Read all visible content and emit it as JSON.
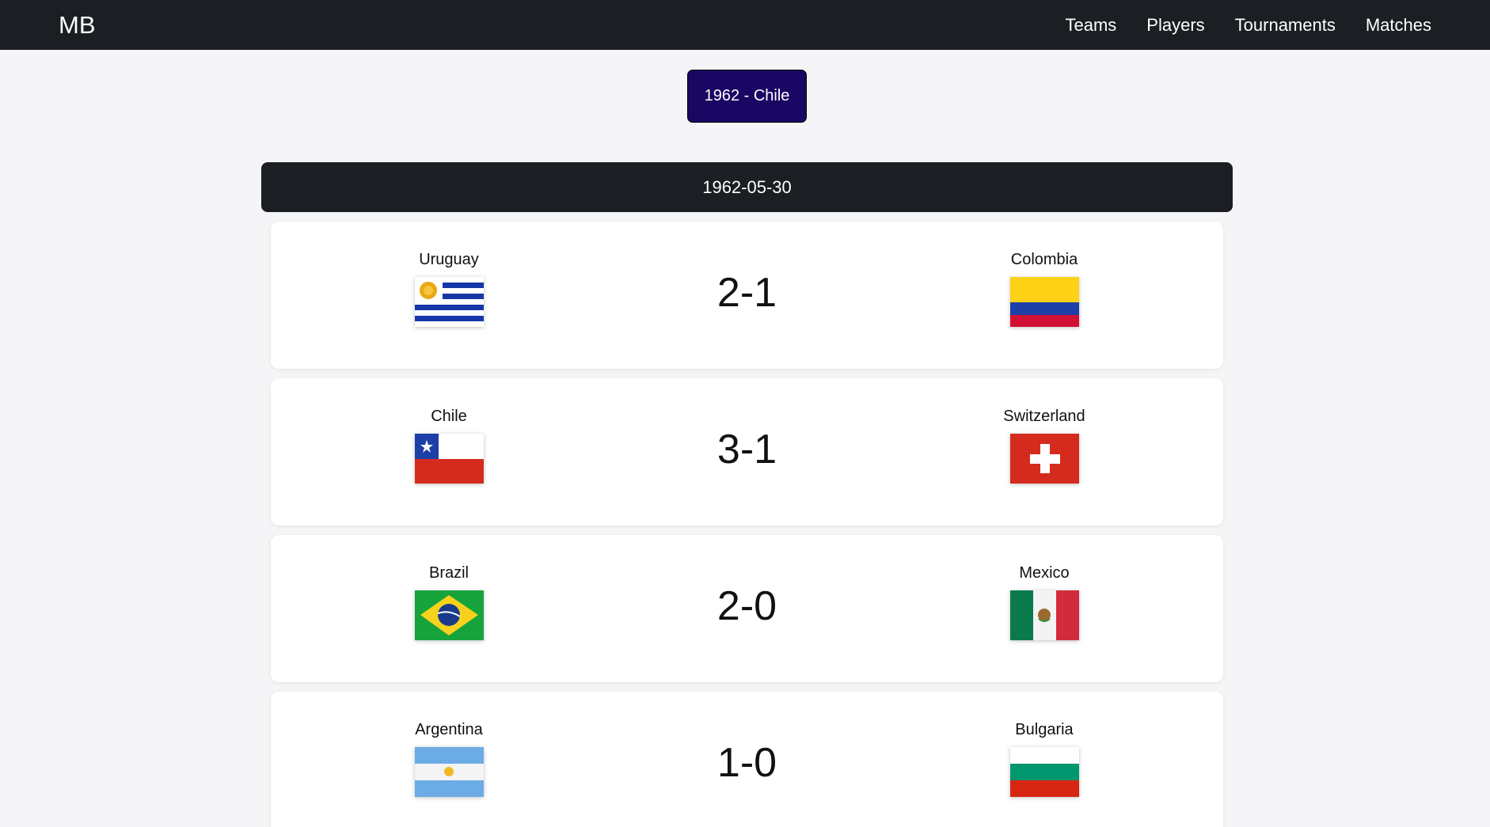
{
  "nav": {
    "brand": "MB",
    "links": [
      "Teams",
      "Players",
      "Tournaments",
      "Matches"
    ]
  },
  "tournament": {
    "label": "1962 - Chile"
  },
  "date": "1962-05-30",
  "matches": [
    {
      "home": {
        "name": "Uruguay",
        "flag": "uruguay-flag"
      },
      "score": "2-1",
      "away": {
        "name": "Colombia",
        "flag": "colombia-flag"
      }
    },
    {
      "home": {
        "name": "Chile",
        "flag": "chile-flag"
      },
      "score": "3-1",
      "away": {
        "name": "Switzerland",
        "flag": "switzerland-flag"
      }
    },
    {
      "home": {
        "name": "Brazil",
        "flag": "brazil-flag"
      },
      "score": "2-0",
      "away": {
        "name": "Mexico",
        "flag": "mexico-flag"
      }
    },
    {
      "home": {
        "name": "Argentina",
        "flag": "argentina-flag"
      },
      "score": "1-0",
      "away": {
        "name": "Bulgaria",
        "flag": "bulgaria-flag"
      }
    }
  ],
  "colors": {
    "navbar": "#1b1e22",
    "tournament_button": "#1a0663",
    "background": "#f5f5f7"
  }
}
